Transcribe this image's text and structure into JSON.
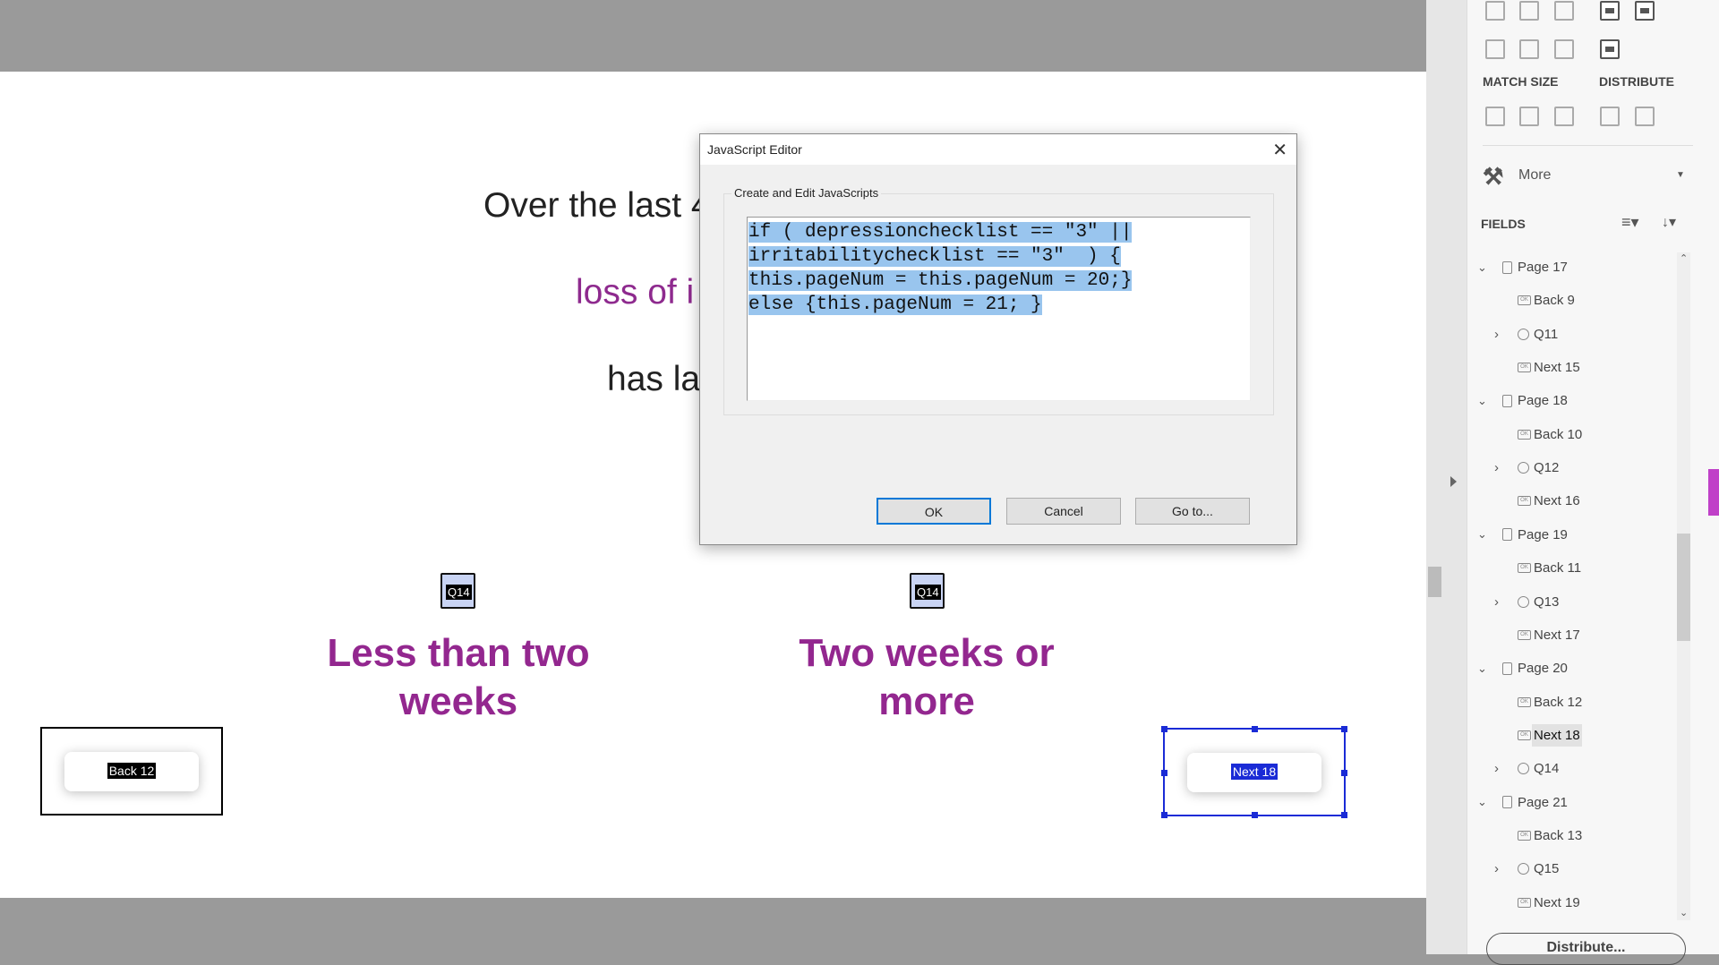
{
  "document": {
    "line1": "Over the last 4",
    "line2": "loss of i",
    "line3": "has la",
    "option1": "Less than two weeks",
    "option2": "Two weeks or more",
    "radio_label": "Q14",
    "back_button": "Back 12",
    "next_button": "Next 18"
  },
  "dialog": {
    "title": "JavaScript Editor",
    "group_label": "Create and Edit JavaScripts",
    "code_lines": [
      "if ( depressionchecklist == \"3\" ||",
      "irritabilitychecklist == \"3\"  ) {",
      "this.pageNum = this.pageNum = 20;}",
      "else {this.pageNum = 21; }"
    ],
    "ok": "OK",
    "cancel": "Cancel",
    "goto": "Go to..."
  },
  "panel": {
    "match_size": "MATCH SIZE",
    "distribute_label": "DISTRIBUTE",
    "more": "More",
    "fields": "FIELDS",
    "distribute_button": "Distribute...",
    "tree": [
      {
        "label": "Page 17",
        "type": "page"
      },
      {
        "label": "Back 9",
        "type": "button"
      },
      {
        "label": "Q11",
        "type": "radio"
      },
      {
        "label": "Next 15",
        "type": "button"
      },
      {
        "label": "Page 18",
        "type": "page"
      },
      {
        "label": "Back 10",
        "type": "button"
      },
      {
        "label": "Q12",
        "type": "radio"
      },
      {
        "label": "Next 16",
        "type": "button"
      },
      {
        "label": "Page 19",
        "type": "page"
      },
      {
        "label": "Back 11",
        "type": "button"
      },
      {
        "label": "Q13",
        "type": "radio"
      },
      {
        "label": "Next 17",
        "type": "button"
      },
      {
        "label": "Page 20",
        "type": "page"
      },
      {
        "label": "Back 12",
        "type": "button"
      },
      {
        "label": "Next 18",
        "type": "button",
        "selected": true
      },
      {
        "label": "Q14",
        "type": "radio"
      },
      {
        "label": "Page 21",
        "type": "page"
      },
      {
        "label": "Back 13",
        "type": "button"
      },
      {
        "label": "Q15",
        "type": "radio"
      },
      {
        "label": "Next 19",
        "type": "button"
      }
    ]
  },
  "colors": {
    "accent_purple": "#93278f",
    "selection_blue": "#1a2bd6",
    "code_highlight": "#99c5ee",
    "side_tab": "#c040c8"
  }
}
